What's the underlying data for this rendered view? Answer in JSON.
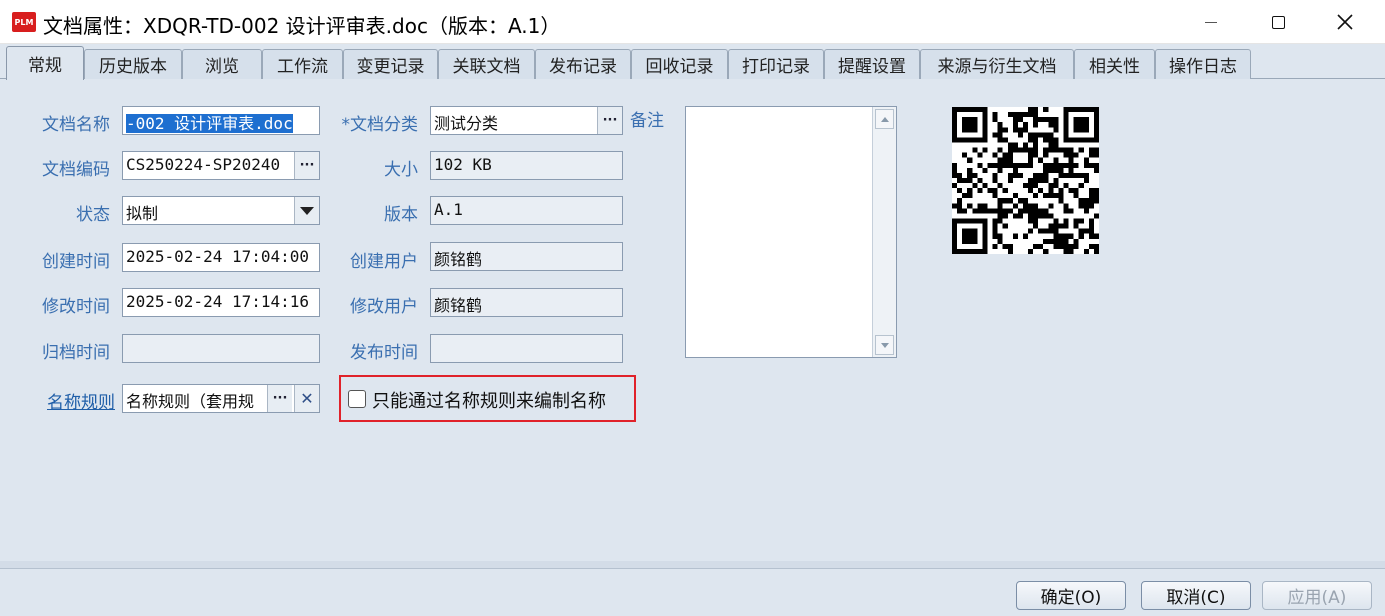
{
  "window": {
    "app_icon_text": "PLM",
    "title": "文档属性：XDQR-TD-002 设计评审表.doc（版本：A.1）"
  },
  "tabs": [
    {
      "label": "常规",
      "active": true
    },
    {
      "label": "历史版本"
    },
    {
      "label": "浏览"
    },
    {
      "label": "工作流"
    },
    {
      "label": "变更记录"
    },
    {
      "label": "关联文档"
    },
    {
      "label": "发布记录"
    },
    {
      "label": "回收记录"
    },
    {
      "label": "打印记录"
    },
    {
      "label": "提醒设置"
    },
    {
      "label": "来源与衍生文档"
    },
    {
      "label": "相关性"
    },
    {
      "label": "操作日志"
    }
  ],
  "form": {
    "doc_name_label": "文档名称",
    "doc_name_value": "-002 设计评审表.doc",
    "doc_code_label": "文档编码",
    "doc_code_value": "CS250224-SP20240",
    "status_label": "状态",
    "status_value": "拟制",
    "created_time_label": "创建时间",
    "created_time_value": "2025-02-24 17:04:00",
    "modified_time_label": "修改时间",
    "modified_time_value": "2025-02-24 17:14:16",
    "archived_time_label": "归档时间",
    "archived_time_value": "",
    "name_rule_label": "名称规则",
    "name_rule_value": "名称规则（套用规",
    "category_label": "*文档分类",
    "category_value": "测试分类",
    "size_label": "大小",
    "size_value": "102 KB",
    "version_label": "版本",
    "version_value": "A.1",
    "created_user_label": "创建用户",
    "created_user_value": "颜铭鹤",
    "modified_user_label": "修改用户",
    "modified_user_value": "颜铭鹤",
    "publish_time_label": "发布时间",
    "publish_time_value": "",
    "remark_label": "备注",
    "remark_value": "",
    "name_rule_only_checkbox_label": "只能通过名称规则来编制名称",
    "name_rule_only_checked": false,
    "dots_button_label": "···",
    "clear_button_label": "✕"
  },
  "buttons": {
    "ok": "确定(O)",
    "cancel": "取消(C)",
    "apply": "应用(A)"
  },
  "colors": {
    "background": "#dee6ef",
    "label_blue": "#3a6fb0",
    "highlight_red": "#e0222a",
    "selection_blue": "#1e6fd0"
  }
}
